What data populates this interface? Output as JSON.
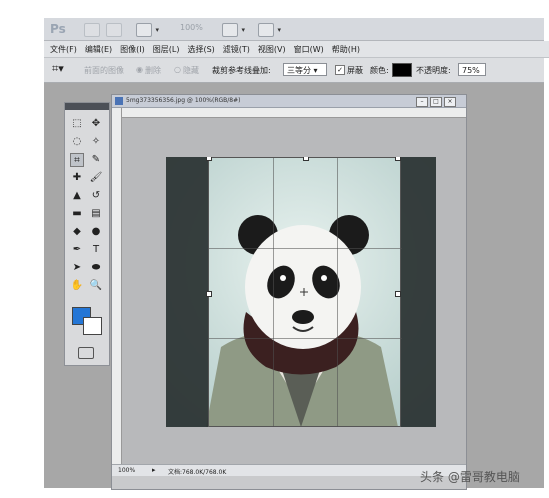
{
  "app": {
    "logo": "Ps",
    "zoom_display": "100%",
    "menus": [
      "文件(F)",
      "编辑(E)",
      "图像(I)",
      "图层(L)",
      "选择(S)",
      "滤镜(T)",
      "视图(V)",
      "窗口(W)",
      "帮助(H)"
    ]
  },
  "options": {
    "front_image": "前面的图像",
    "delete_label": "删除",
    "hide_label": "隐藏",
    "overlay_label": "裁剪参考线叠加:",
    "overlay_value": "三等分",
    "shield_label": "屏蔽",
    "color_label": "颜色:",
    "shield_color": "#000000",
    "opacity_label": "不透明度:",
    "opacity_value": "75%"
  },
  "document": {
    "title": "5mg373356356.jpg @ 100%(RGB/8#)",
    "zoom": "100%",
    "doc_size": "文档:768.0K/768.0K"
  },
  "toolbar_colors": {
    "foreground": "#2476d6",
    "background": "#ffffff"
  },
  "watermark": "头条 @雷哥教电脑"
}
